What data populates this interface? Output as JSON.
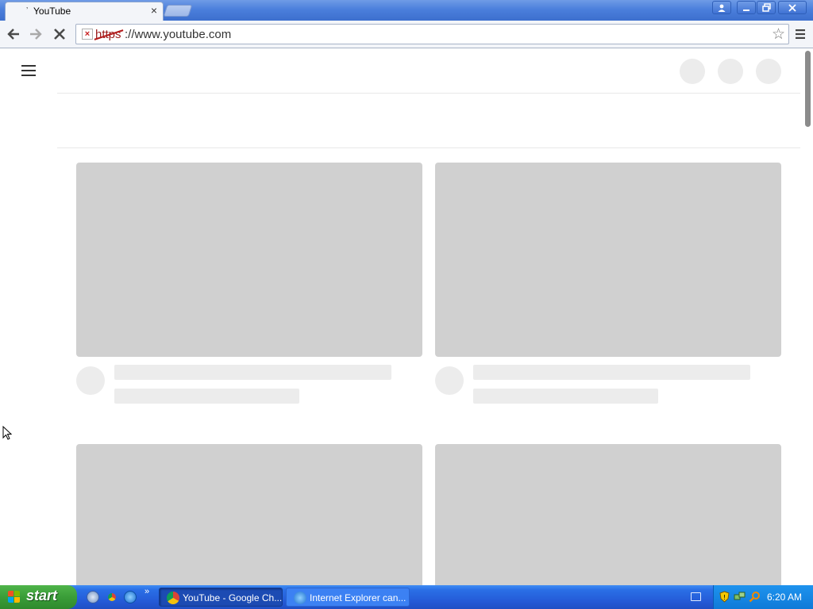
{
  "browser": {
    "tab": {
      "title": "YouTube",
      "favicon": "youtube-favicon",
      "close_glyph": "×"
    },
    "window_buttons": {
      "profile": "person-icon",
      "minimize": "minimize-icon",
      "restore": "restore-icon",
      "close": "close-icon"
    },
    "toolbar": {
      "back": "back-arrow-icon",
      "forward": "forward-arrow-icon",
      "stop": "stop-icon",
      "url_scheme": "https",
      "url_rest": "://www.youtube.com",
      "security_state": "insecure",
      "bookmark": "star-icon",
      "menu": "hamburger-menu-icon"
    }
  },
  "page": {
    "state": "loading-skeleton",
    "header": {
      "menu": "hamburger-icon",
      "placeholder_circles": 3
    },
    "video_cards": [
      {
        "thumbnail": "placeholder",
        "title_line": "placeholder",
        "meta_line": "placeholder"
      },
      {
        "thumbnail": "placeholder",
        "title_line": "placeholder",
        "meta_line": "placeholder"
      },
      {
        "thumbnail": "placeholder"
      },
      {
        "thumbnail": "placeholder"
      }
    ]
  },
  "taskbar": {
    "start_label": "start",
    "quick_launch": [
      "show-desktop-icon",
      "chrome-icon",
      "internet-explorer-icon"
    ],
    "quick_launch_more": "»",
    "tasks": [
      {
        "label": "YouTube - Google Ch...",
        "icon": "chrome-icon",
        "active": true
      },
      {
        "label": "Internet Explorer can...",
        "icon": "internet-explorer-icon",
        "active": false
      }
    ],
    "tray_icons": [
      "keyboard-icon",
      "security-shield-icon",
      "network-icon",
      "search-icon"
    ],
    "clock": "6:20 AM"
  },
  "colors": {
    "titlebar": "#4b7fdc",
    "skeleton_thumb": "#d0d0d0",
    "skeleton_light": "#ececec",
    "start_green": "#3a9d38",
    "taskbar_blue": "#2459d6",
    "insecure_red": "#b21818"
  }
}
